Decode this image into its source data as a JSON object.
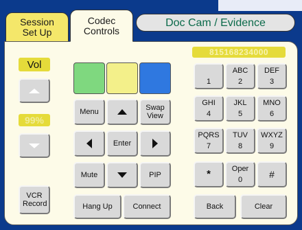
{
  "tabs": {
    "session": "Session Set Up",
    "codec": "Codec Controls",
    "doccam": "Doc Cam / Evidence"
  },
  "volume": {
    "label": "Vol",
    "level_text": "99%",
    "level": 99
  },
  "vcr_record": "VCR Record",
  "swatches": [
    {
      "name": "green",
      "color": "#7fd87f"
    },
    {
      "name": "yellow",
      "color": "#f3f08a"
    },
    {
      "name": "blue",
      "color": "#2f78e0"
    }
  ],
  "controls": {
    "menu": "Menu",
    "swap_view": "Swap View",
    "enter": "Enter",
    "mute": "Mute",
    "pip": "PIP",
    "hang_up": "Hang Up",
    "connect": "Connect"
  },
  "dial_display": "815168234000",
  "keypad": [
    {
      "letters": "",
      "digit": "1"
    },
    {
      "letters": "ABC",
      "digit": "2"
    },
    {
      "letters": "DEF",
      "digit": "3"
    },
    {
      "letters": "GHI",
      "digit": "4"
    },
    {
      "letters": "JKL",
      "digit": "5"
    },
    {
      "letters": "MNO",
      "digit": "6"
    },
    {
      "letters": "PQRS",
      "digit": "7"
    },
    {
      "letters": "TUV",
      "digit": "8"
    },
    {
      "letters": "WXYZ",
      "digit": "9"
    },
    {
      "letters": "",
      "digit": "*"
    },
    {
      "letters": "Oper",
      "digit": "0"
    },
    {
      "letters": "",
      "digit": "#"
    }
  ],
  "back": "Back",
  "clear": "Clear",
  "icons": {
    "vol_up": "triangle-up-icon",
    "vol_down": "triangle-down-icon",
    "nav_up": "arrow-up-icon",
    "nav_down": "arrow-down-icon",
    "nav_left": "arrow-left-icon",
    "nav_right": "arrow-right-icon"
  }
}
